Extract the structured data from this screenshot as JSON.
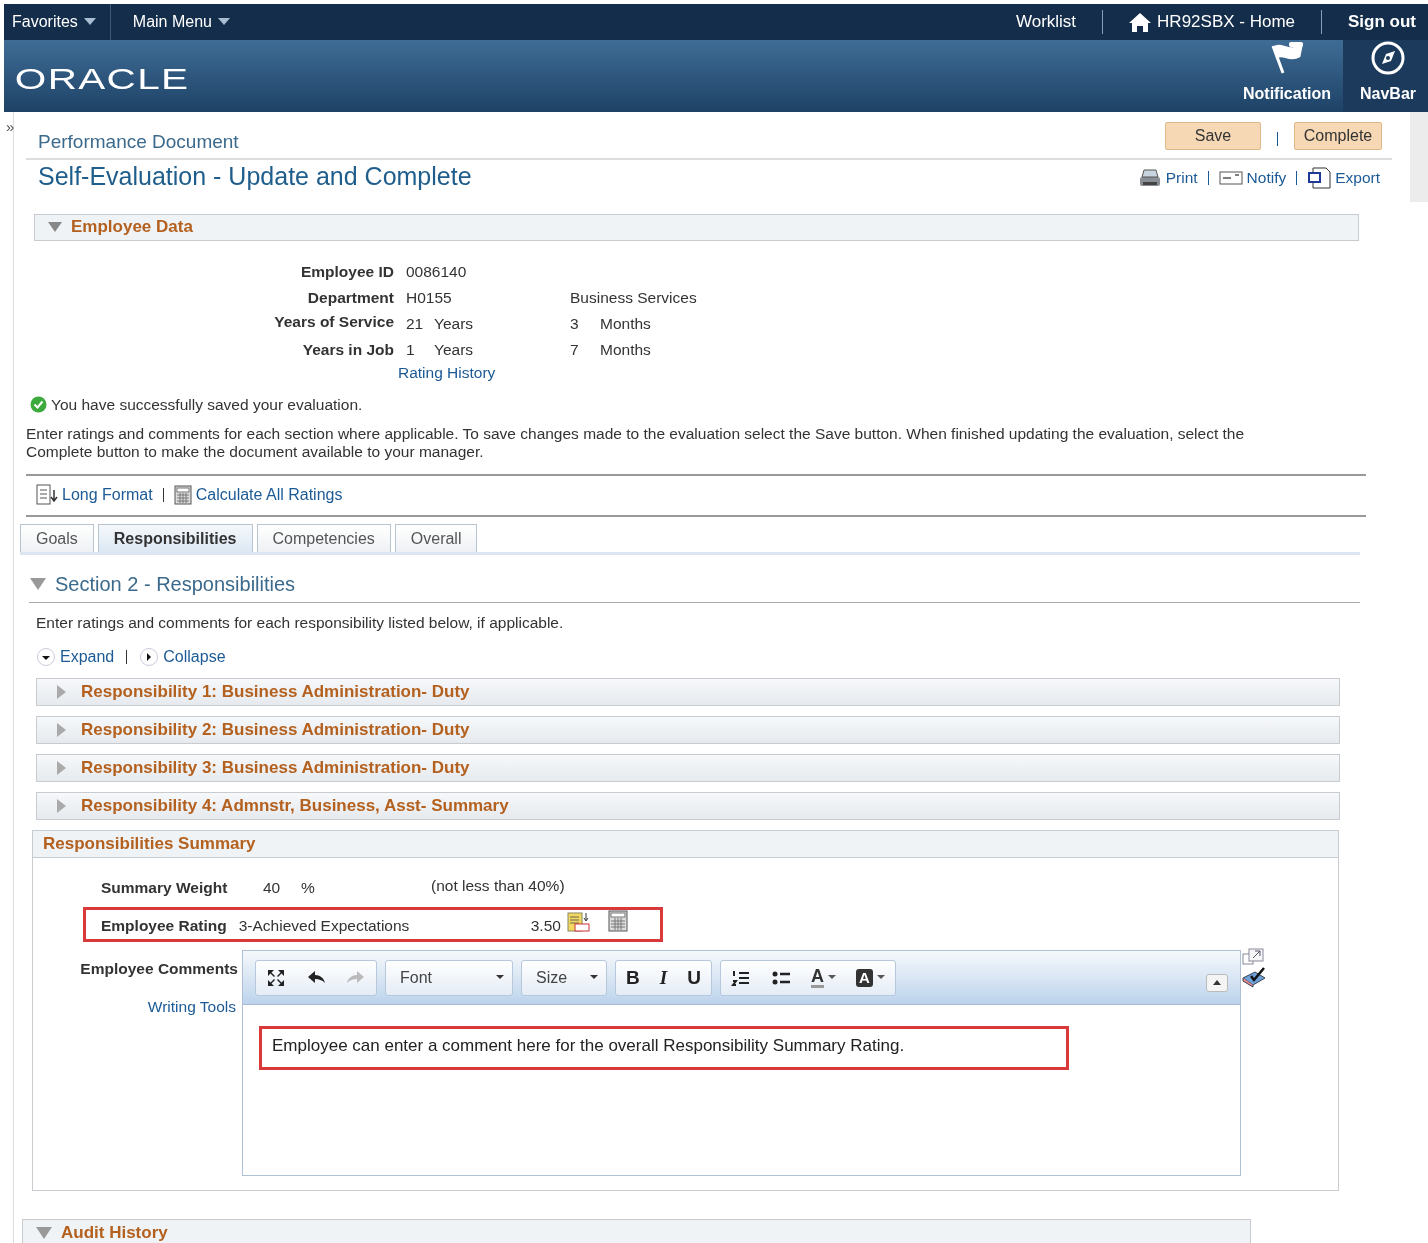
{
  "header": {
    "menus": [
      "Favorites",
      "Main Menu"
    ],
    "links": [
      {
        "kind": "text",
        "label": "Worklist"
      },
      {
        "kind": "home",
        "label": "HR92SBX - Home"
      },
      {
        "kind": "bold",
        "label": "Sign out"
      }
    ],
    "logo": "ORACLE",
    "actions": [
      {
        "kind": "flag",
        "label": "Notification"
      },
      {
        "kind": "compass",
        "label": "NavBar"
      }
    ]
  },
  "sidebar_toggle": "»",
  "page": {
    "breadcrumb": "Performance Document",
    "title": "Self-Evaluation - Update and Complete",
    "buttons": [
      "Save",
      "Complete"
    ],
    "links": [
      {
        "kind": "print",
        "label": "Print"
      },
      {
        "kind": "notify",
        "label": "Notify"
      },
      {
        "kind": "export",
        "label": "Export"
      }
    ]
  },
  "employee_data": {
    "title": "Employee Data",
    "expanded": true,
    "fields": [
      {
        "label": "Employee ID",
        "values": [
          "0086140"
        ]
      },
      {
        "label": "Department",
        "values": [
          "H0155",
          "Business Services"
        ]
      },
      {
        "label": "Years of Service",
        "values": [
          "21",
          "Years",
          "3",
          "Months"
        ]
      },
      {
        "label": "Years in Job",
        "values": [
          "1",
          "Years",
          "7",
          "Months"
        ]
      }
    ],
    "link": "Rating History"
  },
  "message": "You have successfully saved your evaluation.",
  "instructions": "Enter ratings and comments for each section where applicable. To save changes made to the evaluation select the Save button. When finished updating the evaluation, select the Complete button to make the document available to your manager.",
  "toolbar": [
    {
      "kind": "format",
      "label": "Long Format"
    },
    {
      "kind": "calculate",
      "label": "Calculate All Ratings"
    }
  ],
  "tabs": [
    {
      "label": "Goals",
      "selected": false
    },
    {
      "label": "Responsibilities",
      "selected": true
    },
    {
      "label": "Competencies",
      "selected": false
    },
    {
      "label": "Overall",
      "selected": false
    }
  ],
  "section": {
    "title": "Section 2 - Responsibilities",
    "expanded": true,
    "description": "Enter ratings and comments for each responsibility listed below, if applicable.",
    "expand_link": "Expand",
    "collapse_link": "Collapse",
    "items": [
      {
        "title": "Responsibility 1: Business Administration- Duty",
        "expanded": false
      },
      {
        "title": "Responsibility 2: Business Administration- Duty",
        "expanded": false
      },
      {
        "title": "Responsibility 3: Business Administration- Duty",
        "expanded": false
      },
      {
        "title": "Responsibility 4: Admnstr, Business, Asst- Summary",
        "expanded": false
      }
    ]
  },
  "summary": {
    "title": "Responsibilities Summary",
    "weight": {
      "label": "Summary Weight",
      "value": "40",
      "unit": "%",
      "note": "(not less than 40%)"
    },
    "rating": {
      "label": "Employee Rating",
      "value": "3-Achieved Expectations",
      "score": "3.50"
    },
    "comments": {
      "label": "Employee Comments",
      "link": "Writing Tools",
      "editor": {
        "font": "Font",
        "size": "Size",
        "styles": [
          "B",
          "I",
          "U"
        ],
        "colors": [
          "A",
          "A"
        ],
        "text": "Employee can enter a comment here for the overall Responsibility Summary Rating."
      }
    }
  },
  "audit_history": {
    "title": "Audit History",
    "expanded": true
  }
}
